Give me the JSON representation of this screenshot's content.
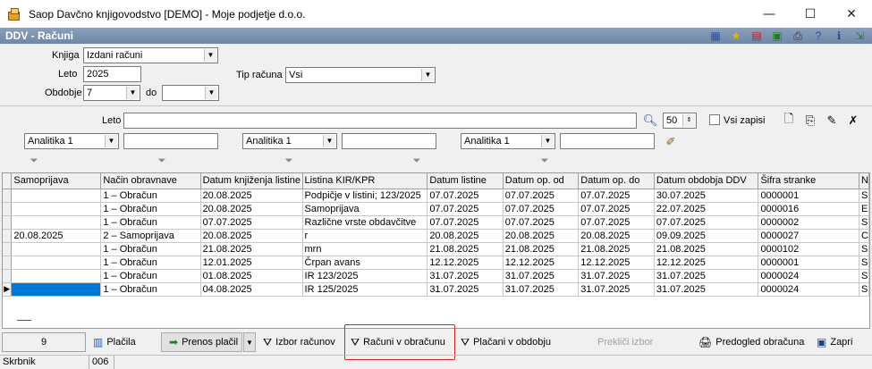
{
  "window": {
    "title": "Saop Davčno knjigovodstvo [DEMO] - Moje podjetje d.o.o.",
    "minimize": "—",
    "maximize": "☐",
    "close": "✕"
  },
  "panel": {
    "title": "DDV - Računi"
  },
  "toolbar_icons": [
    "grid-icon",
    "star-icon",
    "pdf-icon",
    "export-icon",
    "printer-icon",
    "help-icon",
    "info-icon",
    "exit-icon"
  ],
  "form": {
    "knjiga_label": "Knjiga",
    "knjiga_value": "Izdani računi",
    "leto_label": "Leto",
    "leto_value": "2025",
    "obdobje_label": "Obdobje",
    "obdobje_value": "7",
    "do_label": "do",
    "do_value": "",
    "tip_label": "Tip računa",
    "tip_value": "Vsi"
  },
  "filter": {
    "leto_label": "Leto",
    "leto_value": "",
    "count_value": "50",
    "vsi_zapisi_label": "Vsi zapisi",
    "analitika1": "Analitika 1",
    "analitika2": "Analitika 1",
    "analitika3": "Analitika 1"
  },
  "table": {
    "columns": [
      "Samoprijava",
      "Način obravnave",
      "Datum knjiženja listine",
      "Listina KIR/KPR",
      "Datum listine",
      "Datum op. od",
      "Datum op. do",
      "Datum obdobja DDV",
      "Šifra stranke",
      "N"
    ],
    "rows": [
      [
        "",
        "1 – Obračun",
        "20.08.2025",
        "Podpičje v listini; 123/2025",
        "07.07.2025",
        "07.07.2025",
        "07.07.2025",
        "30.07.2025",
        "0000001",
        "S"
      ],
      [
        "",
        "1 – Obračun",
        "20.08.2025",
        "Samoprijava",
        "07.07.2025",
        "07.07.2025",
        "07.07.2025",
        "22.07.2025",
        "0000016",
        "E"
      ],
      [
        "",
        "1 – Obračun",
        "07.07.2025",
        "Različne vrste obdavčitve",
        "07.07.2025",
        "07.07.2025",
        "07.07.2025",
        "07.07.2025",
        "0000002",
        "S"
      ],
      [
        "20.08.2025",
        "2 – Samoprijava",
        "20.08.2025",
        "r",
        "20.08.2025",
        "20.08.2025",
        "20.08.2025",
        "09.09.2025",
        "0000027",
        "C"
      ],
      [
        "",
        "1 – Obračun",
        "21.08.2025",
        "mrn",
        "21.08.2025",
        "21.08.2025",
        "21.08.2025",
        "21.08.2025",
        "0000102",
        "S"
      ],
      [
        "",
        "1 – Obračun",
        "12.01.2025",
        "Črpan avans",
        "12.12.2025",
        "12.12.2025",
        "12.12.2025",
        "12.12.2025",
        "0000001",
        "S"
      ],
      [
        "",
        "1 – Obračun",
        "01.08.2025",
        "IR 123/2025",
        "31.07.2025",
        "31.07.2025",
        "31.07.2025",
        "31.07.2025",
        "0000024",
        "S"
      ],
      [
        "",
        "1 – Obračun",
        "04.08.2025",
        "IR 125/2025",
        "31.07.2025",
        "31.07.2025",
        "31.07.2025",
        "31.07.2025",
        "0000024",
        "S"
      ]
    ]
  },
  "bottom": {
    "count": "9",
    "placila": "Plačila",
    "prenos_placil": "Prenos plačil",
    "izbor_racunov": "Izbor računov",
    "racuni_v_obracunu": "Računi v obračunu",
    "placani_v_obdobju": "Plačani v obdobju",
    "prekici_izbor": "Prekliči izbor",
    "predogled_obracuna": "Predogled obračuna",
    "zapri": "Zapri"
  },
  "status": {
    "user": "Skrbnik",
    "code": "006"
  },
  "colors": {
    "panel_bar": "#7a90b0",
    "selection": "#0078d7",
    "highlight": "#dd2222"
  }
}
